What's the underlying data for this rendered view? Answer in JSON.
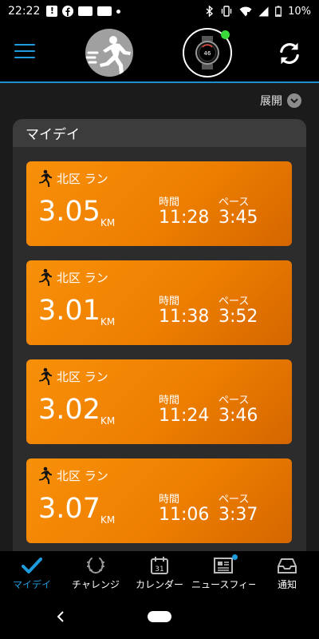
{
  "status_bar": {
    "time": "22:22",
    "battery": "10%"
  },
  "header": {
    "menu_icon": "hamburger-menu-icon",
    "activity_icon": "runner-icon",
    "device_icon": "watch-icon",
    "device_watch_number": "46",
    "device_status_color": "#39d939",
    "sync_icon": "sync-icon",
    "accent_color": "#1e8fcf"
  },
  "expand": {
    "label": "展開"
  },
  "panel": {
    "title": "マイデイ"
  },
  "activities": [
    {
      "name": "北区 ラン",
      "distance": "3.05",
      "unit": "KM",
      "time_label": "時間",
      "time": "11:28",
      "pace_label": "ペース",
      "pace": "3:45"
    },
    {
      "name": "北区 ラン",
      "distance": "3.01",
      "unit": "KM",
      "time_label": "時間",
      "time": "11:38",
      "pace_label": "ペース",
      "pace": "3:52"
    },
    {
      "name": "北区 ラン",
      "distance": "3.02",
      "unit": "KM",
      "time_label": "時間",
      "time": "11:24",
      "pace_label": "ペース",
      "pace": "3:46"
    },
    {
      "name": "北区 ラン",
      "distance": "3.07",
      "unit": "KM",
      "time_label": "時間",
      "time": "11:06",
      "pace_label": "ペース",
      "pace": "3:37"
    }
  ],
  "card_color": "#f08300",
  "bottom_nav": [
    {
      "label": "マイデイ",
      "icon": "checkmark-icon",
      "active": true
    },
    {
      "label": "チャレンジ",
      "icon": "laurel-icon",
      "active": false
    },
    {
      "label": "カレンダー",
      "icon": "calendar-icon",
      "calendar_day": "31",
      "active": false
    },
    {
      "label": "ニュースフィード",
      "icon": "newsfeed-icon",
      "active": false,
      "badge": true
    },
    {
      "label": "通知",
      "icon": "inbox-icon",
      "active": false
    }
  ]
}
